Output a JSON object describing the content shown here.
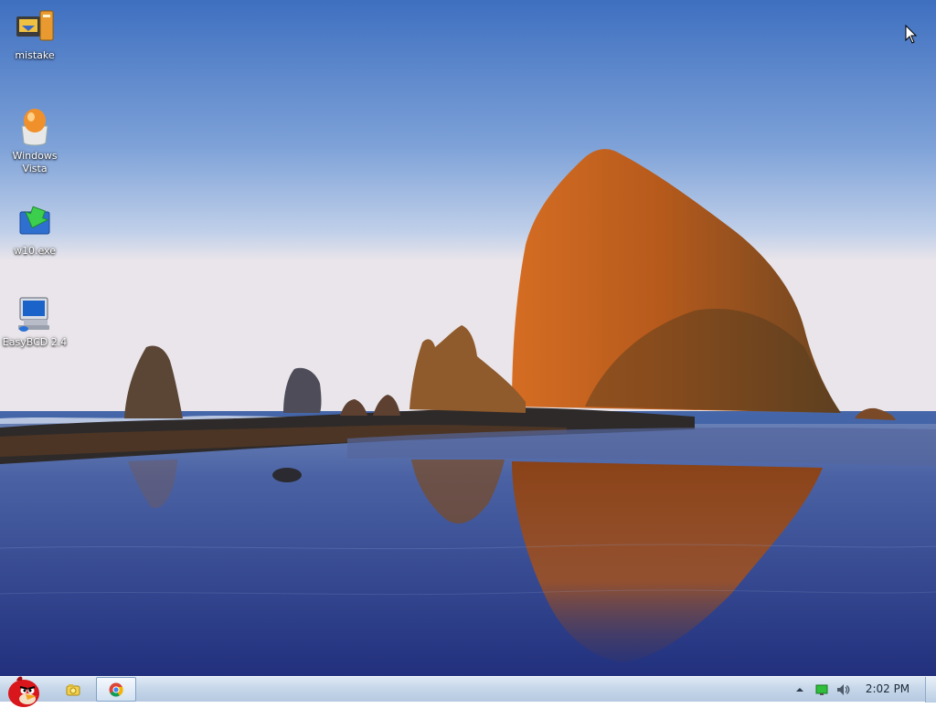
{
  "desktop": {
    "wallpaper": "coastal sea stack at sunset",
    "icons": [
      {
        "label": "mistake",
        "icon": "computer-package-icon"
      },
      {
        "label": "Windows Vista",
        "icon": "egg-installer-icon"
      },
      {
        "label": "w10.exe",
        "icon": "install-arrow-icon"
      },
      {
        "label": "EasyBCD 2.4",
        "icon": "easybcd-computer-icon"
      }
    ]
  },
  "taskbar": {
    "start_icon": "angry-bird-icon",
    "tasks": [
      {
        "icon": "file-explorer-icon",
        "active": false
      },
      {
        "icon": "chrome-icon",
        "active": true
      }
    ],
    "tray": {
      "icons": [
        "show-hidden-icons-arrow",
        "network-icon",
        "volume-icon"
      ],
      "clock": "2:02 PM"
    }
  },
  "colors": {
    "taskbar": "#c7d7ea",
    "sky_top": "#3f6fc1",
    "rock": "#b65a1c"
  }
}
